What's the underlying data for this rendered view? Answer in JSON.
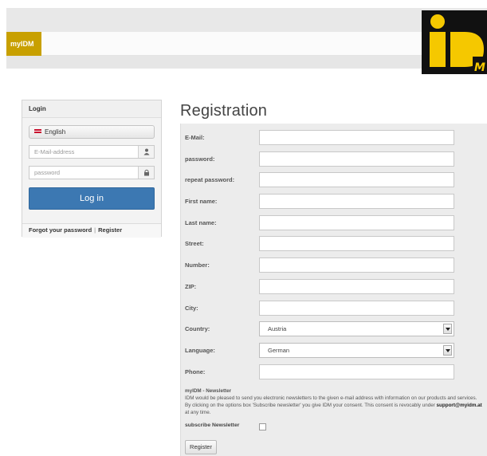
{
  "header": {
    "brand": "myIDM"
  },
  "logo": {
    "big_letters": "iD",
    "small_letter": "M",
    "bg_color": "#111111",
    "accent_color": "#f5c800"
  },
  "login": {
    "title": "Login",
    "language_label": "English",
    "email_placeholder": "E-Mail-address",
    "password_placeholder": "password",
    "login_button": "Log in",
    "forgot_link": "Forgot your password",
    "separator": "|",
    "register_link": "Register"
  },
  "registration": {
    "title": "Registration",
    "fields": [
      {
        "label": "E-Mail:",
        "type": "text",
        "value": ""
      },
      {
        "label": "password:",
        "type": "text",
        "value": ""
      },
      {
        "label": "repeat password:",
        "type": "text",
        "value": ""
      },
      {
        "label": "First name:",
        "type": "text",
        "value": ""
      },
      {
        "label": "Last name:",
        "type": "text",
        "value": ""
      },
      {
        "label": "Street:",
        "type": "text",
        "value": ""
      },
      {
        "label": "Number:",
        "type": "text",
        "value": ""
      },
      {
        "label": "ZIP:",
        "type": "text",
        "value": ""
      },
      {
        "label": "City:",
        "type": "text",
        "value": ""
      },
      {
        "label": "Country:",
        "type": "select",
        "value": "Austria"
      },
      {
        "label": "Language:",
        "type": "select",
        "value": "German"
      },
      {
        "label": "Phone:",
        "type": "text",
        "value": ""
      }
    ],
    "newsletter_title": "myIDM - Newsletter",
    "newsletter_text_1": "IDM would be pleased to send you electronic newsletters to the given e-mail address with information on our products and services. By clicking on the options box 'Subscribe newsletter' you give IDM your consent. This consent is revocably under",
    "newsletter_email": "support@myidm.at",
    "newsletter_text_2": "at any time.",
    "subscribe_label": "subscribe Newsletter",
    "register_button": "Register"
  },
  "colors": {
    "brand": "#c8a000",
    "primary_button": "#3c78b2",
    "panel_bg": "#ececec"
  }
}
